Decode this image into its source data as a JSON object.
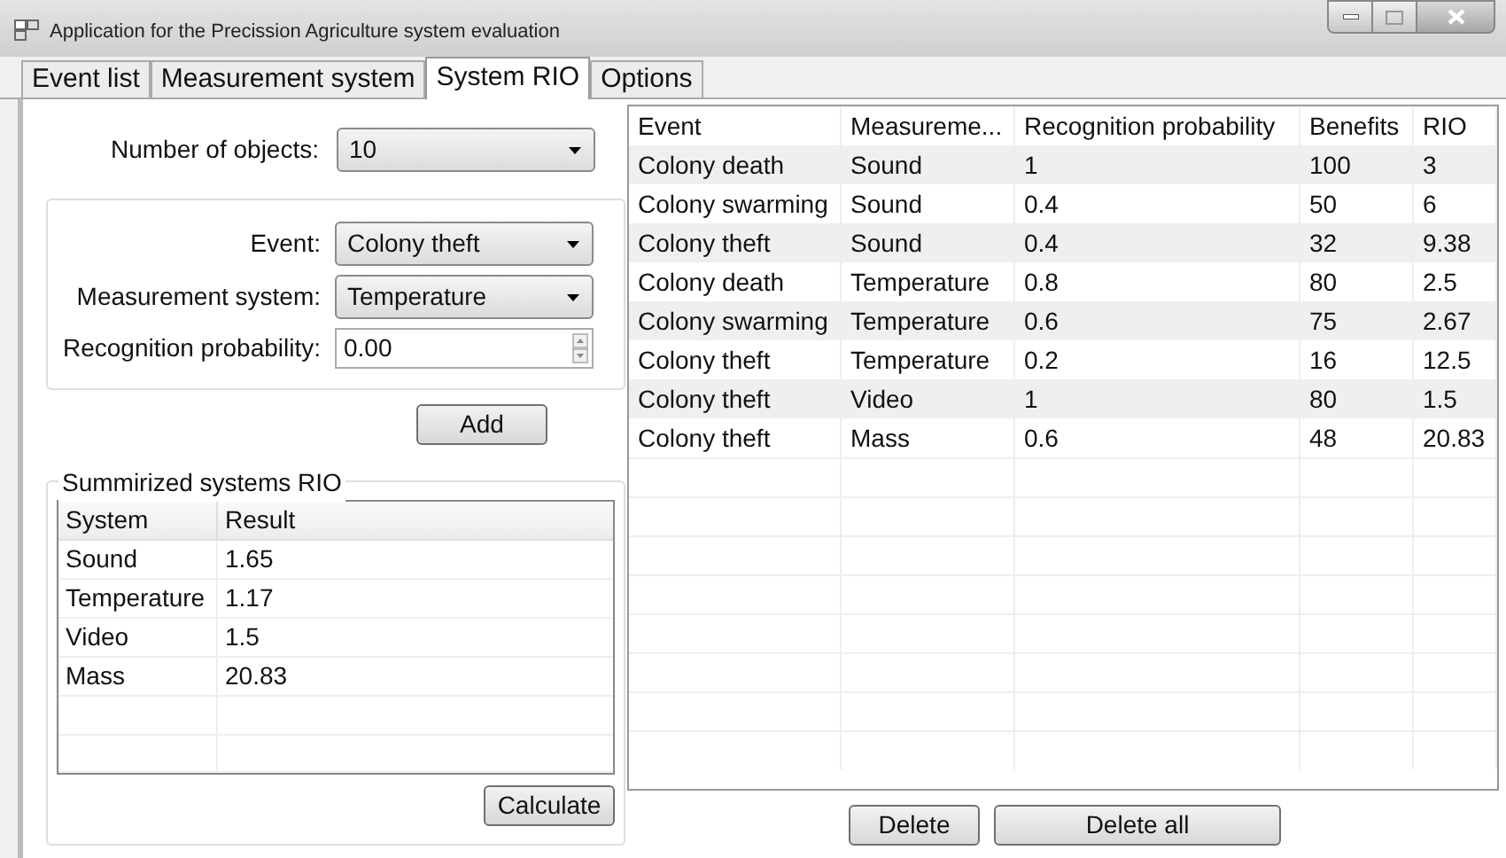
{
  "window": {
    "title": "Application for the Precission Agriculture system evaluation"
  },
  "tabs": [
    {
      "label": "Event list",
      "selected": false
    },
    {
      "label": "Measurement system",
      "selected": false
    },
    {
      "label": "System RIO",
      "selected": true
    },
    {
      "label": "Options",
      "selected": false
    }
  ],
  "number_of_objects": {
    "label": "Number of objects:",
    "value": "10"
  },
  "event_form": {
    "fields": [
      {
        "kind": "combo",
        "label": "Event:",
        "value": "Colony theft"
      },
      {
        "kind": "combo",
        "label": "Measurement system:",
        "value": "Temperature"
      },
      {
        "kind": "spin",
        "label": "Recognition probability:",
        "value": "0.00"
      }
    ],
    "add_button": "Add"
  },
  "summary": {
    "title": "Summirized systems RIO",
    "columns": [
      "System",
      "Result"
    ],
    "rows": [
      [
        "Sound",
        "1.65"
      ],
      [
        "Temperature",
        "1.17"
      ],
      [
        "Video",
        "1.5"
      ],
      [
        "Mass",
        "20.83"
      ]
    ],
    "calculate_button": "Calculate"
  },
  "table": {
    "columns": [
      "Event",
      "Measureme...",
      "Recognition probability",
      "Benefits",
      "RIO"
    ],
    "rows": [
      [
        "Colony death",
        "Sound",
        "1",
        "100",
        "3"
      ],
      [
        "Colony swarming",
        "Sound",
        "0.4",
        "50",
        "6"
      ],
      [
        "Colony theft",
        "Sound",
        "0.4",
        "32",
        "9.38"
      ],
      [
        "Colony death",
        "Temperature",
        "0.8",
        "80",
        "2.5"
      ],
      [
        "Colony swarming",
        "Temperature",
        "0.6",
        "75",
        "2.67"
      ],
      [
        "Colony theft",
        "Temperature",
        "0.2",
        "16",
        "12.5"
      ],
      [
        "Colony theft",
        "Video",
        "1",
        "80",
        "1.5"
      ],
      [
        "Colony theft",
        "Mass",
        "0.6",
        "48",
        "20.83"
      ]
    ]
  },
  "buttons": [
    "Delete",
    "Delete all"
  ]
}
